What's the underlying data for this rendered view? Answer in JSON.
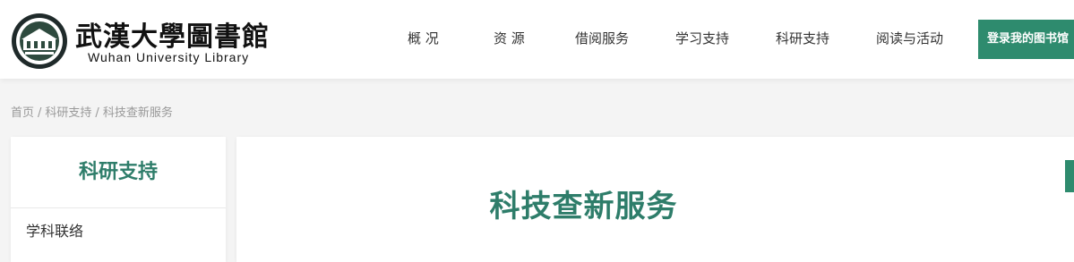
{
  "header": {
    "logo": {
      "name_cn": "武漢大學圖書館",
      "name_en": "Wuhan University Library",
      "emblem_text": "WUHAN UNIVERSITY"
    },
    "nav": [
      {
        "label": "概 况"
      },
      {
        "label": "资 源"
      },
      {
        "label": "借阅服务"
      },
      {
        "label": "学习支持"
      },
      {
        "label": "科研支持"
      },
      {
        "label": "阅读与活动"
      }
    ],
    "login_label": "登录我的图书馆"
  },
  "breadcrumb": {
    "items": [
      "首页",
      "科研支持",
      "科技查新服务"
    ],
    "separator": "/"
  },
  "sidebar": {
    "title": "科研支持",
    "items": [
      {
        "label": "学科联络"
      }
    ]
  },
  "main": {
    "title": "科技查新服务"
  },
  "colors": {
    "accent": "#2e8b6e",
    "title_green": "#2e7d6a"
  }
}
